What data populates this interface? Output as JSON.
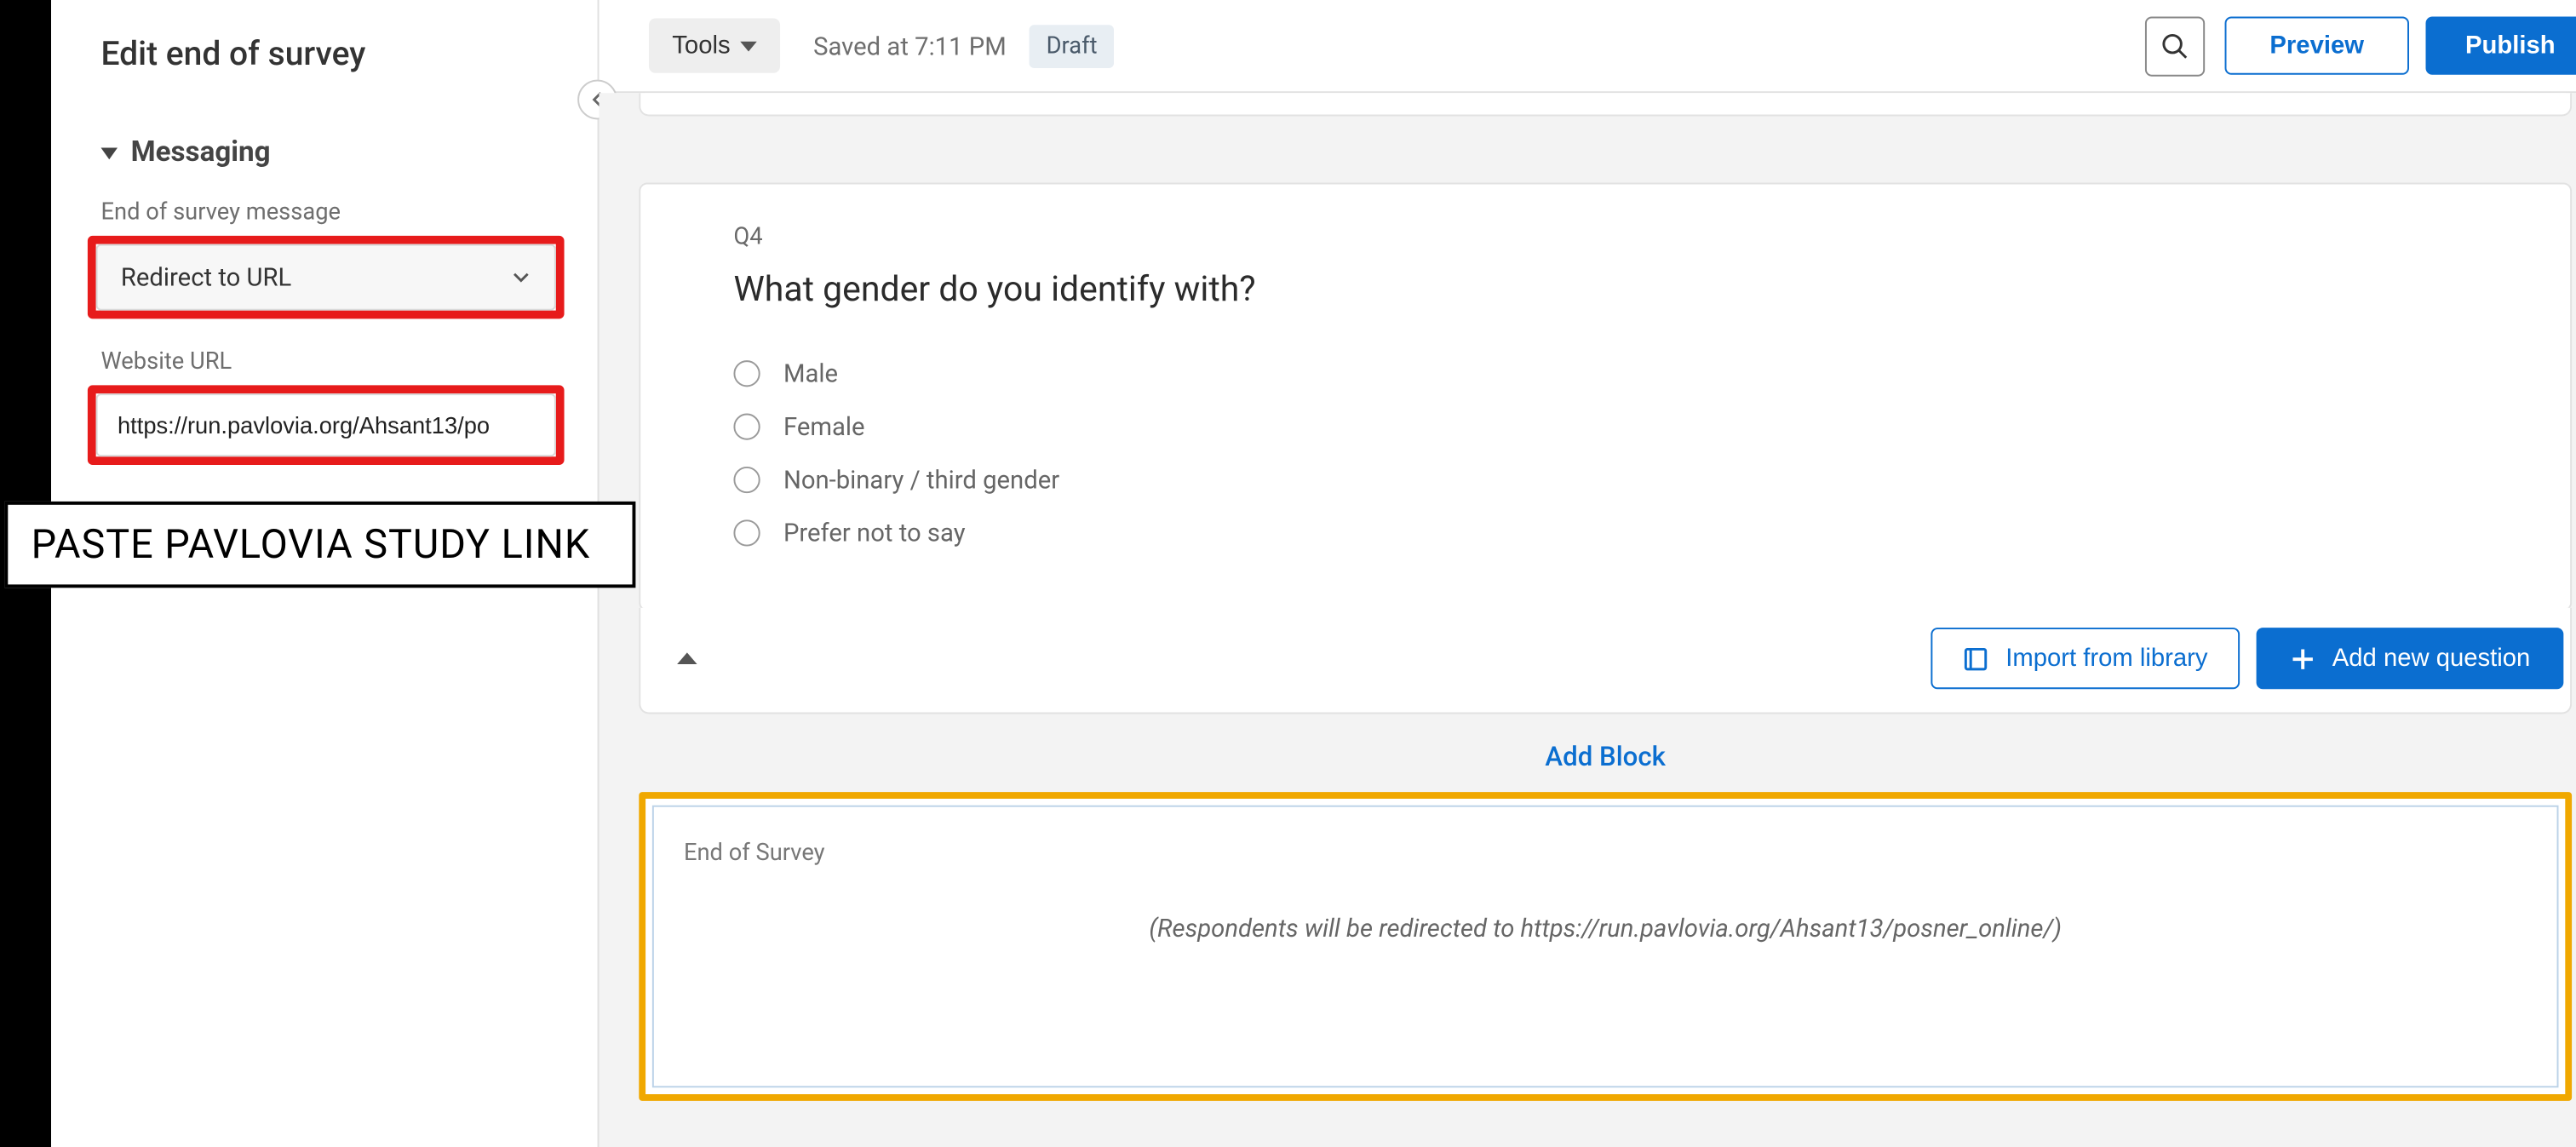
{
  "topbar": {
    "tools_label": "Tools",
    "saved_text": "Saved at 7:11 PM",
    "draft_label": "Draft",
    "preview_label": "Preview",
    "publish_label": "Publish"
  },
  "sidebar": {
    "title": "Edit end of survey",
    "section_messaging": "Messaging",
    "eos_message_label": "End of survey message",
    "eos_message_selected": "Redirect to URL",
    "website_url_label": "Website URL",
    "website_url_value": "https://run.pavlovia.org/Ahsant13/po"
  },
  "annotation": {
    "text": "PASTE PAVLOVIA STUDY LINK"
  },
  "question": {
    "code": "Q4",
    "title": "What gender do you identify with?",
    "options": [
      "Male",
      "Female",
      "Non-binary / third gender",
      "Prefer not to say"
    ]
  },
  "actions": {
    "import_library_label": "Import from library",
    "add_question_label": "Add new question",
    "add_block_label": "Add Block"
  },
  "end_of_survey": {
    "heading": "End of Survey",
    "message": "(Respondents will be redirected to https://run.pavlovia.org/Ahsant13/posner_online/)"
  }
}
